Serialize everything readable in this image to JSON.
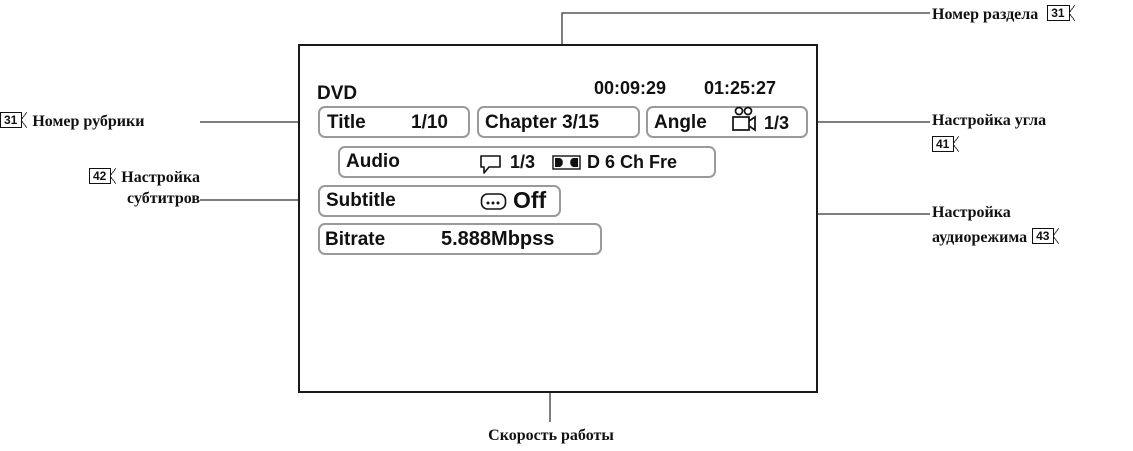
{
  "osd": {
    "disc": "DVD",
    "time": "00:09:29",
    "total_time": "01:25:27",
    "title_label": "Title",
    "title_value": "1/10",
    "chapter": "Chapter 3/15",
    "angle_label": "Angle",
    "angle_value": "1/3",
    "audio_label": "Audio",
    "audio_value": "1/3",
    "audio_format": "D 6 Ch Fre",
    "subtitle_label": "Subtitle",
    "subtitle_value": "Off",
    "bitrate_label": "Bitrate",
    "bitrate_value": "5.888Mbpss"
  },
  "callouts": {
    "chapter_number": {
      "text": "Номер раздела",
      "ref": "31"
    },
    "title_number": {
      "text": "Номер рубрики",
      "ref": "31"
    },
    "angle_setting": {
      "text": "Настройка угла",
      "ref": "41"
    },
    "subtitle_setting": {
      "line1": "Настройка",
      "line2": "субтитров",
      "ref": "42"
    },
    "audio_setting": {
      "line1": "Настройка",
      "line2": "аудиорежима",
      "ref": "43"
    },
    "bitrate": {
      "text": "Скорость работы"
    }
  },
  "icons": {
    "speech": "speech-bubble-icon",
    "dolby": "dolby-digital-icon",
    "camera": "camera-angle-icon",
    "subtitle": "subtitle-icon"
  }
}
